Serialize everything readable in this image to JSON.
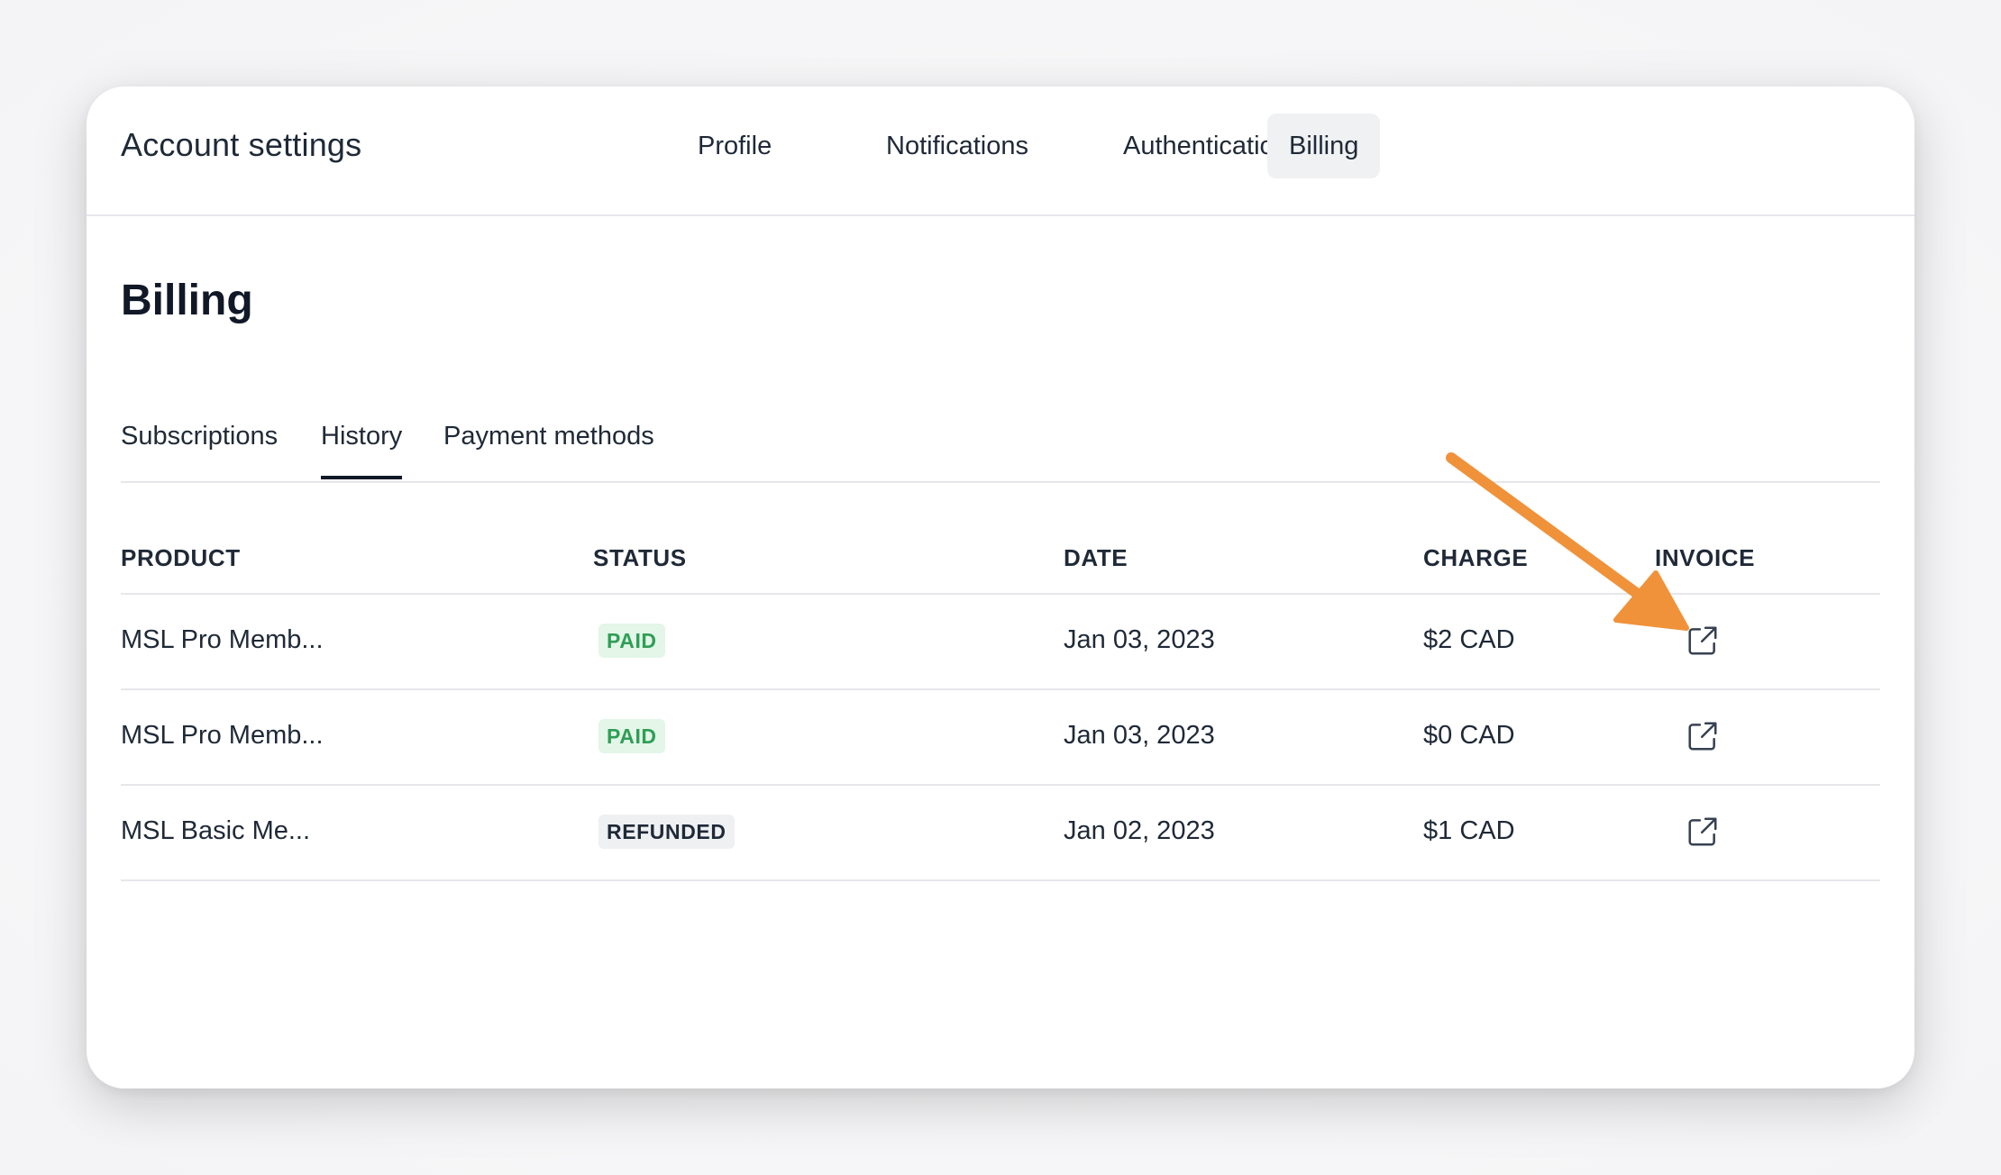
{
  "header": {
    "title": "Account settings",
    "tabs": [
      {
        "label": "Profile",
        "active": false
      },
      {
        "label": "Notifications",
        "active": false
      },
      {
        "label": "Authentication",
        "active": false
      },
      {
        "label": "Billing",
        "active": true
      }
    ]
  },
  "main": {
    "title": "Billing",
    "subtabs": [
      {
        "label": "Subscriptions",
        "active": false
      },
      {
        "label": "History",
        "active": true
      },
      {
        "label": "Payment methods",
        "active": false
      }
    ],
    "table": {
      "columns": [
        "PRODUCT",
        "STATUS",
        "DATE",
        "CHARGE",
        "INVOICE"
      ],
      "rows": [
        {
          "product": "MSL Pro Memb...",
          "status": "PAID",
          "date": "Jan 03, 2023",
          "charge": "$2 CAD",
          "invoice_icon": "external-link-icon"
        },
        {
          "product": "MSL Pro Memb...",
          "status": "PAID",
          "date": "Jan 03, 2023",
          "charge": "$0 CAD",
          "invoice_icon": "external-link-icon"
        },
        {
          "product": "MSL Basic Me...",
          "status": "REFUNDED",
          "date": "Jan 02, 2023",
          "charge": "$1 CAD",
          "invoice_icon": "external-link-icon"
        }
      ]
    }
  },
  "annotation": {
    "arrow_color": "#f0923a",
    "icon": "arrow-pointer"
  },
  "colors": {
    "paid_bg": "#e3f6e8",
    "paid_text": "#2f9e55",
    "refunded_bg": "#eef0f2",
    "divider": "#e5e7eb",
    "active_tab_bg": "#f0f1f3"
  }
}
